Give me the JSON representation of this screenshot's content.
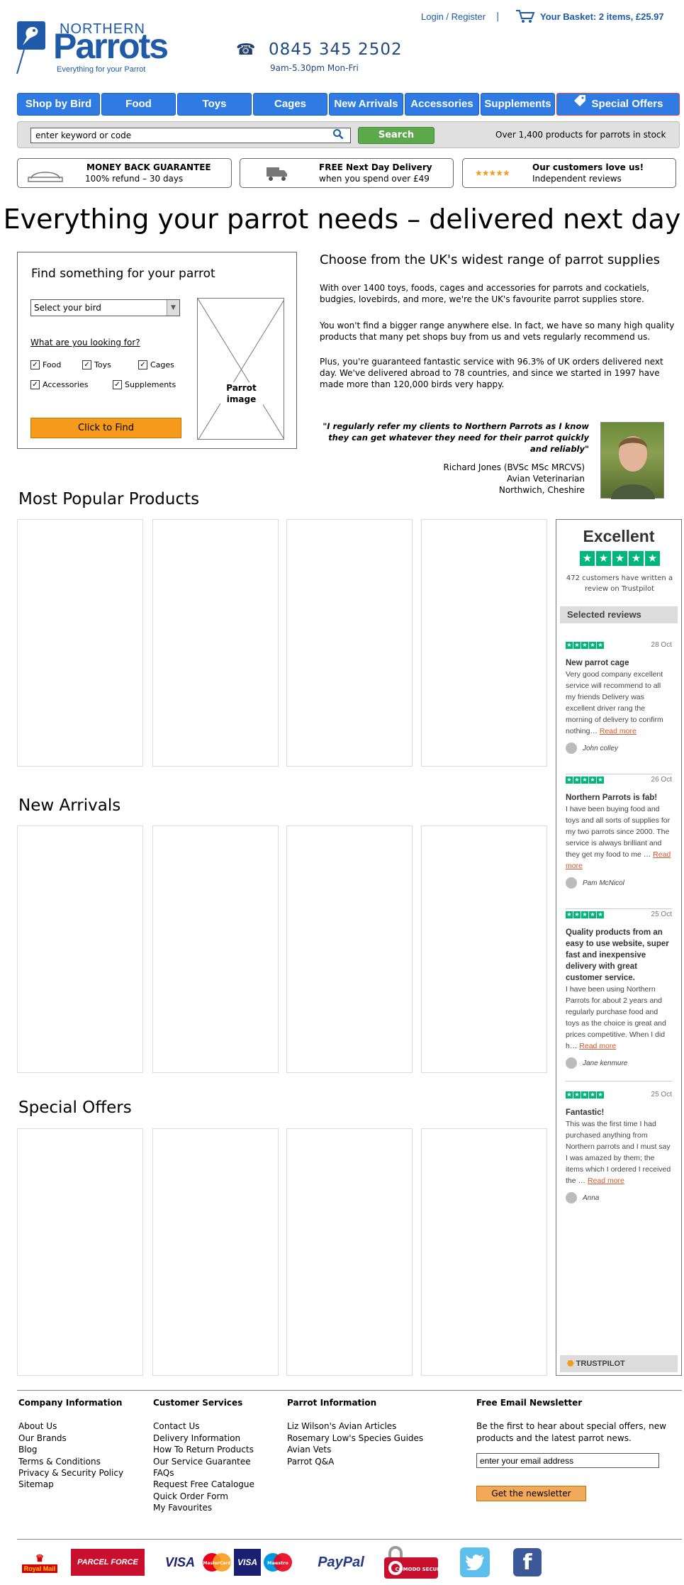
{
  "header": {
    "logo_top": "NORTHERN",
    "logo_main": "Parrots",
    "logo_tagline": "Everything for your Parrot",
    "login_register": "Login / Register",
    "separator": "|",
    "basket": "Your Basket:  2 items, £25.97",
    "phone": "0845 345 2502",
    "hours": "9am-5.30pm Mon-Fri"
  },
  "nav": {
    "items": [
      "Shop by Bird",
      "Food",
      "Toys",
      "Cages",
      "New Arrivals",
      "Accessories",
      "Supplements"
    ],
    "special": "Special Offers"
  },
  "search": {
    "placeholder": "enter keyword or code",
    "button": "Search",
    "note": "Over 1,400 products for parrots in stock"
  },
  "promos": [
    {
      "title": "MONEY BACK GUARANTEE",
      "sub": "100% refund – 30 days"
    },
    {
      "title": "FREE Next Day Delivery",
      "sub": "when you spend over £49"
    },
    {
      "title": "Our customers love us!",
      "sub": "Independent reviews"
    }
  ],
  "hero": {
    "title": "Everything your parrot needs – delivered next day"
  },
  "finder": {
    "title": "Find something for your parrot",
    "select": "Select your bird",
    "lookfor": "What are you looking for?",
    "options": [
      "Food",
      "Toys",
      "Cages",
      "Accessories",
      "Supplements"
    ],
    "button": "Click to Find",
    "image_label": "Parrot image"
  },
  "intro": {
    "title": "Choose from the UK's widest range of parrot supplies",
    "p1": "With over 1400 toys, foods, cages and accessories for parrots and cockatiels, budgies, lovebirds, and more, we're the UK's favourite parrot supplies store.",
    "p2": "You won't find a bigger range anywhere else. In fact, we have so many high quality products that many pet shops buy from us and vets regularly recommend us.",
    "p3": "Plus, you're guaranteed fantastic service with 96.3% of UK orders delivered next day. We've delivered abroad to 78 countries, and since we started in 1997 have made more than 120,000 birds very happy.",
    "quote": "\"I regularly refer my clients to Northern Parrots as I know they can get whatever they need for their parrot quickly and reliably\"",
    "quote_name": "Richard Jones (BVSc MSc MRCVS)",
    "quote_role": "Avian Veterinarian",
    "quote_place": "Northwich, Cheshire"
  },
  "sections": {
    "popular": "Most Popular Products",
    "new": "New Arrivals",
    "offers": "Special Offers"
  },
  "trustpilot": {
    "rating": "Excellent",
    "count": "472 customers have written a review on Trustpilot",
    "selected": "Selected reviews",
    "brand": "TRUSTPILOT",
    "reviews": [
      {
        "date": "28 Oct",
        "title": "New parrot cage",
        "body": "Very good company excellent service will recommend to all my friends Delivery was excellent driver rang the morning of delivery to confirm nothing…",
        "more": "Read more",
        "author": "John colley"
      },
      {
        "date": "26 Oct",
        "title": "Northern Parrots is fab!",
        "body": "I have been buying food and toys and all sorts of supplies for my two parrots since 2000. The service is always brilliant and they get my food to me …",
        "more": "Read more",
        "author": "Pam McNicol"
      },
      {
        "date": "25 Oct",
        "title": "Quality products from an easy to use website, super fast and inexpensive delivery with great customer service.",
        "body": "I have been using Northern Parrots for about 2 years and regularly purchase food and toys as the choice is great and prices competitive. When I did h…",
        "more": "Read more",
        "author": "Jane kenmure"
      },
      {
        "date": "25 Oct",
        "title": "Fantastic!",
        "body": "This was the first time I had purchased anything from Northern parrots and I must say I was amazed by them; the items which I ordered I received the …",
        "more": "Read more",
        "author": "Anna"
      }
    ]
  },
  "footer": {
    "company": {
      "title": "Company Information",
      "links": [
        "About Us",
        "Our Brands",
        "Blog",
        "Terms & Conditions",
        "Privacy & Security Policy",
        "Sitemap"
      ]
    },
    "customer": {
      "title": "Customer Services",
      "links": [
        "Contact Us",
        "Delivery Information",
        "How To Return Products",
        "Our Service Guarantee",
        "FAQs",
        "Request Free Catalogue",
        "Quick Order Form",
        "My Favourites"
      ]
    },
    "parrot": {
      "title": "Parrot Information",
      "links": [
        "Liz Wilson's Avian Articles",
        "Rosemary Low's Species Guides",
        "Avian Vets",
        "Parrot Q&A"
      ]
    },
    "newsletter": {
      "title": "Free Email Newsletter",
      "text": "Be the first to hear about special offers, new products and the latest parrot news.",
      "placeholder": "enter your email address",
      "button": "Get the newsletter"
    },
    "logos": {
      "royal_mail": "Royal Mail",
      "parcelforce": "PARCEL FORCE",
      "visa": "VISA",
      "mastercard": "MasterCard",
      "visa_debit": "VISA",
      "maestro": "Maestro",
      "paypal": "PayPal",
      "comodo": "COMODO SECURE"
    }
  }
}
